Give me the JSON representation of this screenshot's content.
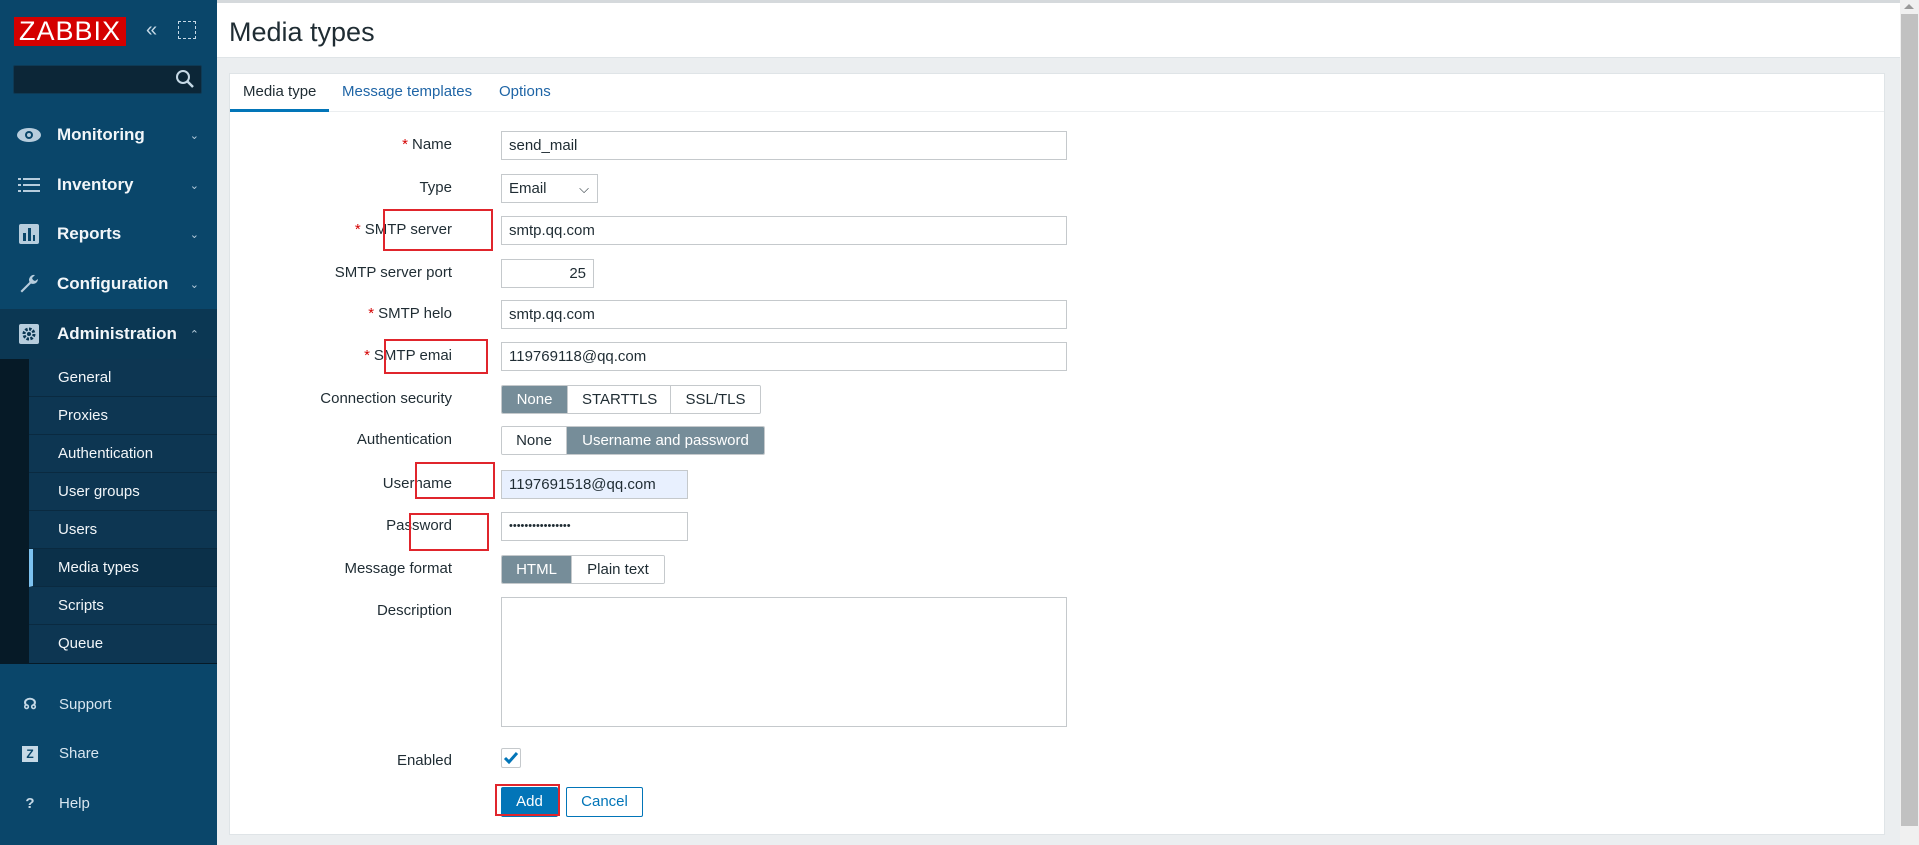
{
  "sidebar": {
    "logo": "ZABBIX",
    "search_placeholder": "",
    "menu": [
      {
        "label": "Monitoring",
        "icon": "eye-icon"
      },
      {
        "label": "Inventory",
        "icon": "list-icon"
      },
      {
        "label": "Reports",
        "icon": "bar-chart-icon"
      },
      {
        "label": "Configuration",
        "icon": "wrench-icon"
      },
      {
        "label": "Administration",
        "icon": "gear-icon",
        "expanded": true
      }
    ],
    "submenu": [
      "General",
      "Proxies",
      "Authentication",
      "User groups",
      "Users",
      "Media types",
      "Scripts",
      "Queue"
    ],
    "active_submenu": "Media types",
    "footer": [
      {
        "label": "Support",
        "icon": "headset-icon"
      },
      {
        "label": "Share",
        "icon": "share-z-icon",
        "glyph": "Z"
      },
      {
        "label": "Help",
        "icon": "help-icon",
        "glyph": "?"
      }
    ]
  },
  "header": {
    "title": "Media types"
  },
  "tabs": [
    "Media type",
    "Message templates",
    "Options"
  ],
  "form": {
    "name": {
      "label": "Name",
      "value": "send_mail"
    },
    "type": {
      "label": "Type",
      "value": "Email"
    },
    "smtp_server": {
      "label": "SMTP server",
      "value": "smtp.qq.com"
    },
    "smtp_port": {
      "label": "SMTP server port",
      "value": "25"
    },
    "smtp_helo": {
      "label": "SMTP helo",
      "value": "smtp.qq.com"
    },
    "smtp_email": {
      "label": "SMTP emai",
      "value": "119769118@qq.com"
    },
    "connection_security": {
      "label": "Connection security",
      "options": [
        "None",
        "STARTTLS",
        "SSL/TLS"
      ],
      "selected": "None"
    },
    "authentication": {
      "label": "Authentication",
      "options": [
        "None",
        "Username and password"
      ],
      "selected": "Username and password"
    },
    "username": {
      "label": "Username",
      "value": "1197691518@qq.com"
    },
    "password": {
      "label": "Password",
      "value": "••••••••••••••••"
    },
    "message_format": {
      "label": "Message format",
      "options": [
        "HTML",
        "Plain text"
      ],
      "selected": "HTML"
    },
    "description": {
      "label": "Description",
      "value": ""
    },
    "enabled": {
      "label": "Enabled",
      "checked": true
    },
    "add_label": "Add",
    "cancel_label": "Cancel"
  },
  "colors": {
    "sidebar": "#0a466a",
    "accent": "#0275b8",
    "selected_segment": "#768d99",
    "highlight_box": "#e0252c",
    "required": "#d40000"
  }
}
